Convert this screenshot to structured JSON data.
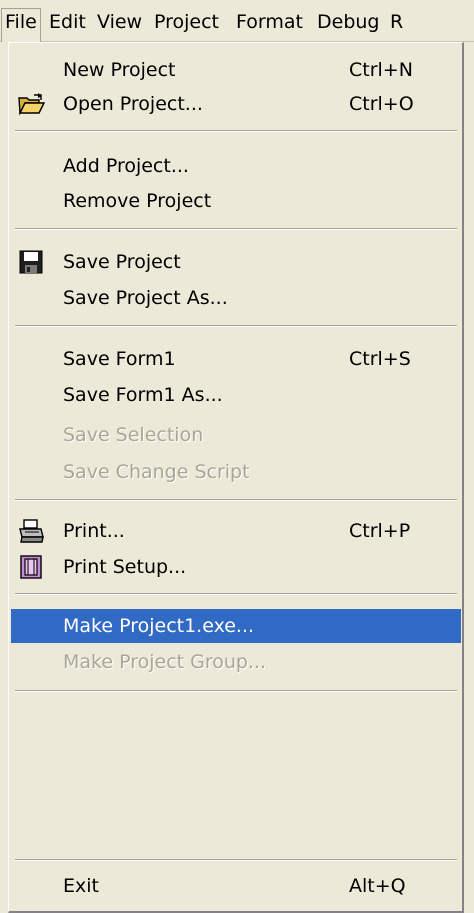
{
  "menubar": [
    {
      "label": "File"
    },
    {
      "label": "Edit"
    },
    {
      "label": "View"
    },
    {
      "label": "Project"
    },
    {
      "label": "Format"
    },
    {
      "label": "Debug"
    },
    {
      "label": "R"
    }
  ],
  "menu": {
    "new_project": {
      "label": "New Project",
      "shortcut": "Ctrl+N"
    },
    "open_project": {
      "label": "Open Project...",
      "shortcut": "Ctrl+O"
    },
    "add_project": {
      "label": "Add Project..."
    },
    "remove_project": {
      "label": "Remove Project"
    },
    "save_project": {
      "label": "Save Project"
    },
    "save_project_as": {
      "label": "Save Project As..."
    },
    "save_form": {
      "label": "Save Form1",
      "shortcut": "Ctrl+S"
    },
    "save_form_as": {
      "label": "Save Form1 As..."
    },
    "save_selection": {
      "label": "Save Selection"
    },
    "save_change_script": {
      "label": "Save Change Script"
    },
    "print": {
      "label": "Print...",
      "shortcut": "Ctrl+P"
    },
    "print_setup": {
      "label": "Print Setup..."
    },
    "make_exe": {
      "label": "Make Project1.exe..."
    },
    "make_group": {
      "label": "Make Project Group..."
    },
    "exit": {
      "label": "Exit",
      "shortcut": "Alt+Q"
    }
  },
  "colors": {
    "menu_bg": "#ece9d8",
    "highlight_bg": "#316ac5",
    "disabled_text": "#a9a696"
  }
}
